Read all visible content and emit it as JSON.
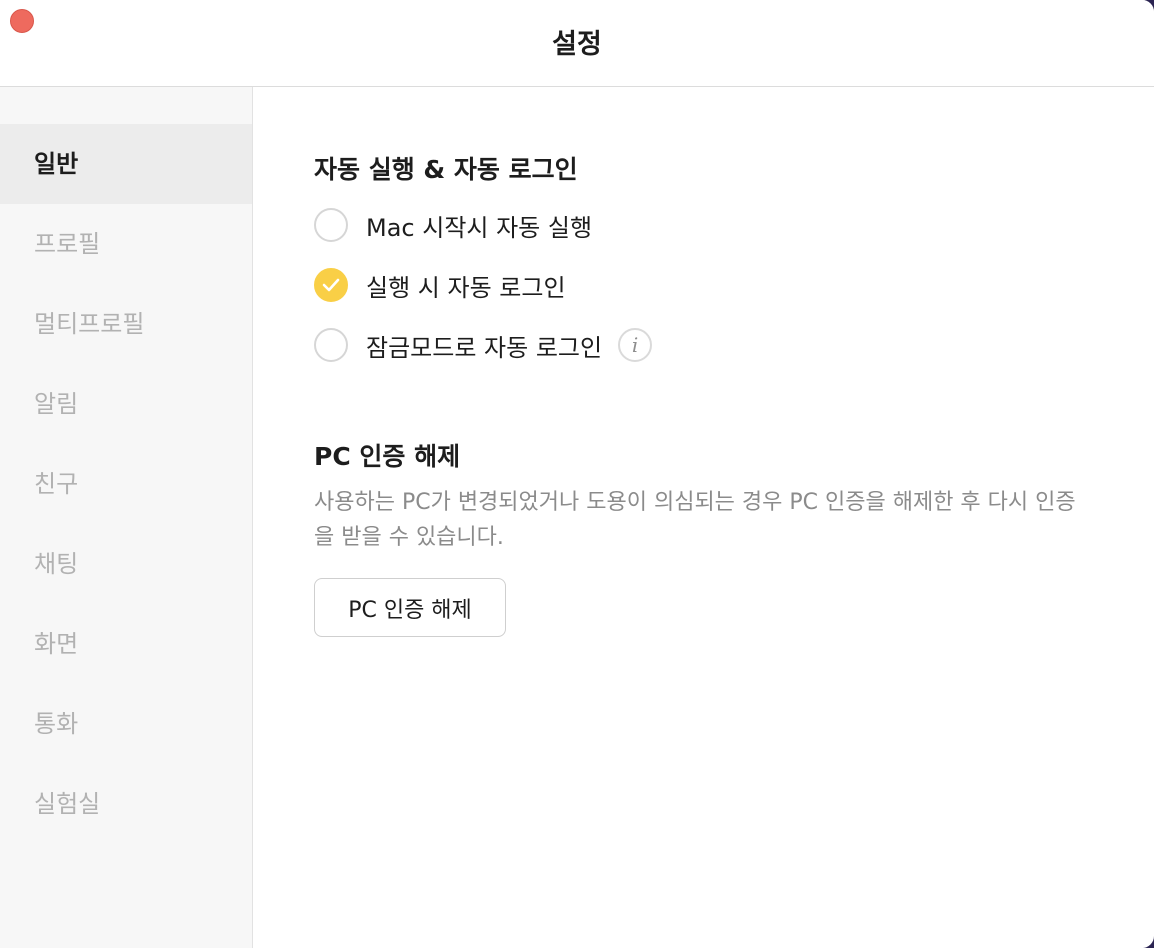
{
  "window": {
    "title": "설정"
  },
  "sidebar": {
    "items": [
      {
        "label": "일반",
        "active": true
      },
      {
        "label": "프로필",
        "active": false
      },
      {
        "label": "멀티프로필",
        "active": false
      },
      {
        "label": "알림",
        "active": false
      },
      {
        "label": "친구",
        "active": false
      },
      {
        "label": "채팅",
        "active": false
      },
      {
        "label": "화면",
        "active": false
      },
      {
        "label": "통화",
        "active": false
      },
      {
        "label": "실험실",
        "active": false
      }
    ]
  },
  "autorun": {
    "title": "자동 실행 & 자동 로그인",
    "options": [
      {
        "label": "Mac 시작시 자동 실행",
        "checked": false
      },
      {
        "label": "실행 시 자동 로그인",
        "checked": true
      },
      {
        "label": "잠금모드로 자동 로그인",
        "checked": false,
        "info_icon": "info-icon"
      }
    ],
    "info_glyph": "i"
  },
  "pc_auth": {
    "title": "PC 인증 해제",
    "description": "사용하는 PC가 변경되었거나 도용이 의심되는 경우 PC 인증을 해제한 후 다시 인증을 받을 수 있습니다.",
    "button_label": "PC 인증 해제"
  },
  "colors": {
    "accent_yellow": "#f9cf46",
    "close_red": "#ee6a5e",
    "muted_text": "#b2b2b2"
  }
}
